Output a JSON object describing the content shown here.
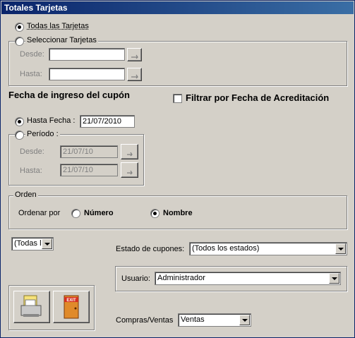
{
  "window": {
    "title": "Totales Tarjetas"
  },
  "tarjetas": {
    "todas_label": "Todas las Tarjetas",
    "seleccionar_label": "Seleccionar Tarjetas",
    "desde_label": "Desde:",
    "hasta_label": "Hasta:",
    "desde_value": "",
    "hasta_value": "",
    "selected": "todas"
  },
  "fecha": {
    "heading": "Fecha de ingreso del cupón",
    "filtrar_label": "Filtrar por Fecha de Acreditación",
    "hasta_fecha_label": "Hasta Fecha :",
    "hasta_fecha_value": "21/07/2010",
    "periodo_label": "Período :",
    "desde_label": "Desde:",
    "hasta_label": "Hasta:",
    "desde_value": "21/07/10",
    "hasta_value": "21/07/10"
  },
  "orden": {
    "group_title": "Orden",
    "ordenar_label": "Ordenar por",
    "numero_label": "Número",
    "nombre_label": "Nombre",
    "selected": "nombre"
  },
  "filtros": {
    "todas_select": "(Todas l",
    "estado_label": "Estado de cupones:",
    "estado_value": "(Todos los estados)",
    "usuario_label": "Usuario:",
    "usuario_value": "Administrador",
    "compras_label": "Compras/Ventas",
    "compras_value": "Ventas"
  }
}
